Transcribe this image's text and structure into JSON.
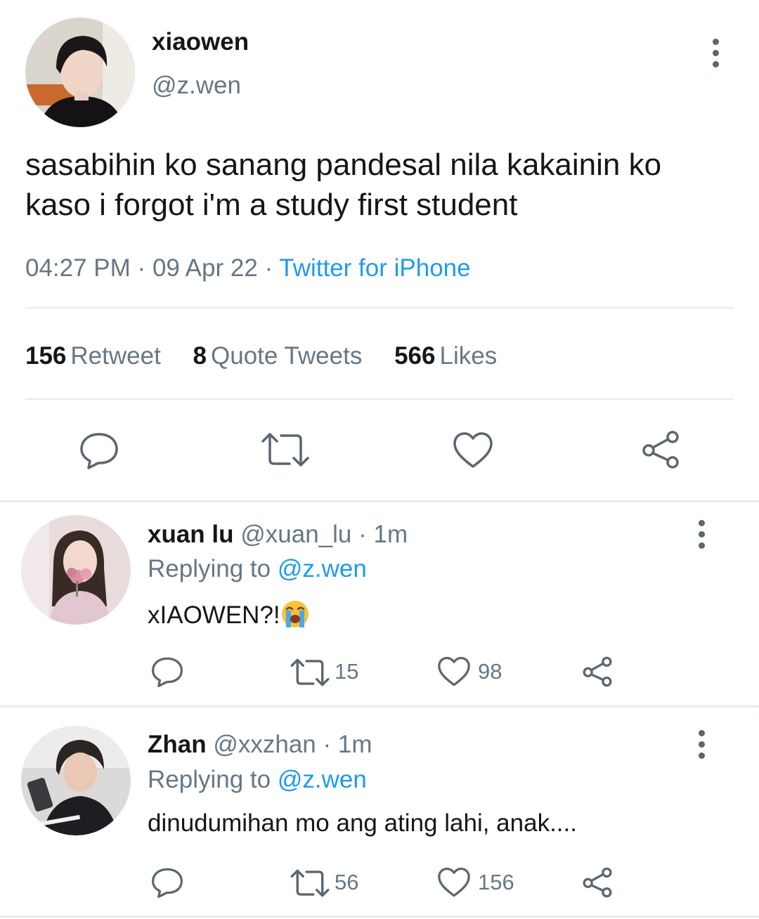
{
  "tweet": {
    "display_name": "xiaowen",
    "handle": "@z.wen",
    "text": "sasabihin ko sanang pandesal nila kakainin ko kaso i forgot i'm a study first student",
    "time": "04:27 PM",
    "date": "09 Apr 22",
    "separator": "·",
    "source": "Twitter for iPhone",
    "stats": {
      "retweets": "156",
      "retweets_label": "Retweet",
      "quotes": "8",
      "quotes_label": "Quote Tweets",
      "likes": "566",
      "likes_label": "Likes"
    }
  },
  "replies": [
    {
      "name": "xuan lu",
      "handle": "@xuan_lu",
      "time": "· 1m",
      "replying_label": "Replying to",
      "replying_to": "@z.wen",
      "text": "xIAOWEN?!",
      "emoji": "loudly-crying-face",
      "retweets": "15",
      "likes": "98"
    },
    {
      "name": "Zhan",
      "handle": "@xxzhan",
      "time": "· 1m",
      "replying_label": "Replying to",
      "replying_to": "@z.wen",
      "text": "dinudumihan mo ang ating lahi, anak....",
      "retweets": "56",
      "likes": "156"
    }
  ],
  "colors": {
    "text": "#14171a",
    "secondary": "#657786",
    "link": "#1d9bf0",
    "divider": "#e6ecf0"
  }
}
